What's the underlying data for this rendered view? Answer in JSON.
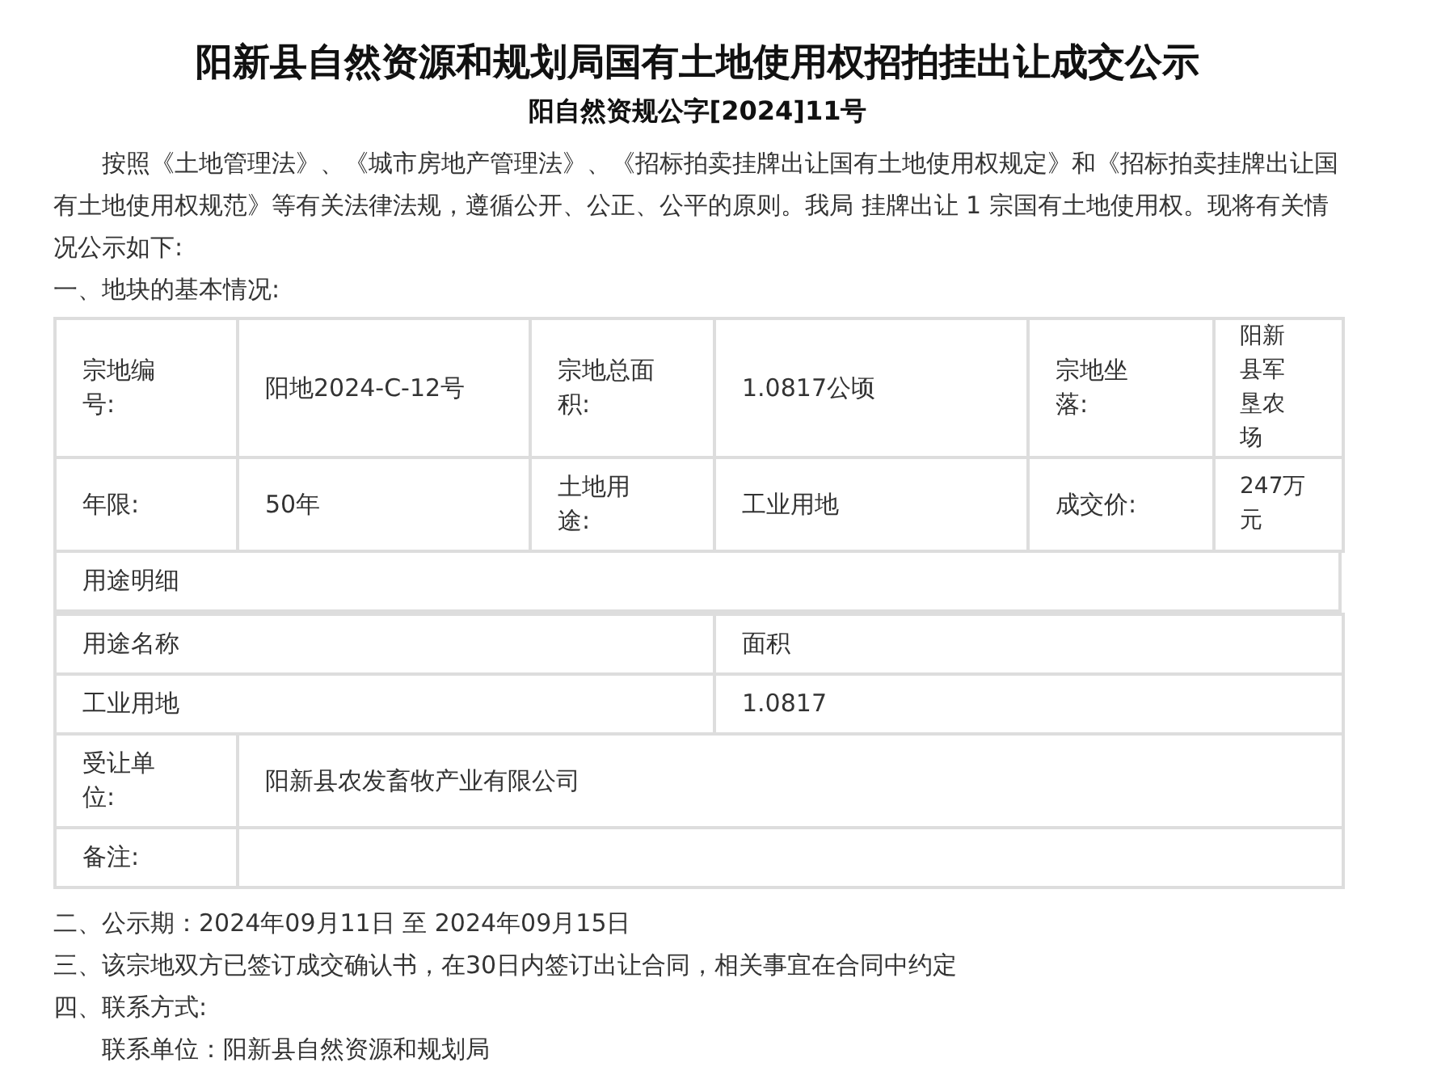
{
  "title": "阳新县自然资源和规划局国有土地使用权招拍挂出让成交公示",
  "subtitle": "阳自然资规公字[2024]11号",
  "intro": "按照《土地管理法》、《城市房地产管理法》、《招标拍卖挂牌出让国有土地使用权规定》和《招标拍卖挂牌出让国有土地使用权规范》等有关法律法规，遵循公开、公正、公平的原则。我局 挂牌出让 1 宗国有土地使用权。现将有关情况公示如下:",
  "section_1": "一、地块的基本情况:",
  "parcel_table": {
    "rows": [
      [
        "宗地编号:",
        "阳地2024-C-12号",
        "宗地总面积:",
        "1.0817公顷",
        "宗地坐落:",
        "阳新县军垦农场"
      ],
      [
        "年限:",
        "50年",
        "土地用途:",
        "工业用地",
        "成交价:",
        "247万元"
      ]
    ]
  },
  "usage_heading": "用途明细",
  "usage_table": {
    "columns": [
      "用途名称",
      "面积"
    ],
    "rows": [
      [
        "工业用地",
        "1.0817"
      ]
    ]
  },
  "other_table": {
    "rows": [
      {
        "label": "受让单位:",
        "value": "阳新县农发畜牧产业有限公司"
      },
      {
        "label": "备注:"
      }
    ]
  },
  "sections": [
    "二、公示期：2024年09月11日 至 2024年09月15日",
    "三、该宗地双方已签订成交确认书，在30日内签订出让合同，相关事宜在合同中约定",
    "四、联系方式:"
  ],
  "contact": "联系单位：阳新县自然资源和规划局"
}
